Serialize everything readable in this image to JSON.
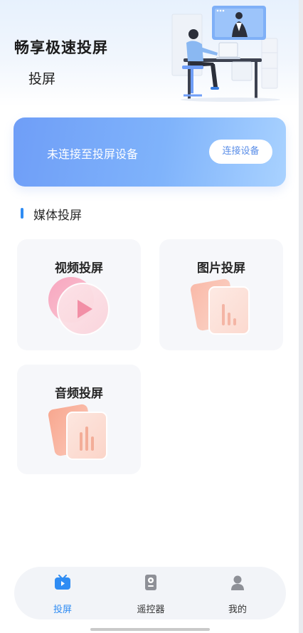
{
  "header": {
    "title": "畅享极速投屏",
    "subtitle": "投屏",
    "illustration_icon": "person-at-desk-video-call-illustration"
  },
  "banner": {
    "status_text": "未连接至投屏设备",
    "connect_label": "连接设备"
  },
  "section": {
    "title": "媒体投屏",
    "accent_color": "#2f8cf3"
  },
  "cards": [
    {
      "label": "视频投屏",
      "icon": "video-play-icon"
    },
    {
      "label": "图片投屏",
      "icon": "image-chart-icon"
    },
    {
      "label": "音频投屏",
      "icon": "audio-chart-icon"
    }
  ],
  "nav": {
    "items": [
      {
        "label": "投屏",
        "icon": "tv-icon",
        "active": true
      },
      {
        "label": "遥控器",
        "icon": "remote-icon",
        "active": false
      },
      {
        "label": "我的",
        "icon": "user-icon",
        "active": false
      }
    ],
    "active_color": "#2f8cf3"
  },
  "colors": {
    "banner_gradient_start": "#6f9ef7",
    "banner_gradient_end": "#a9d2ff",
    "card_background": "#f6f7fa"
  }
}
